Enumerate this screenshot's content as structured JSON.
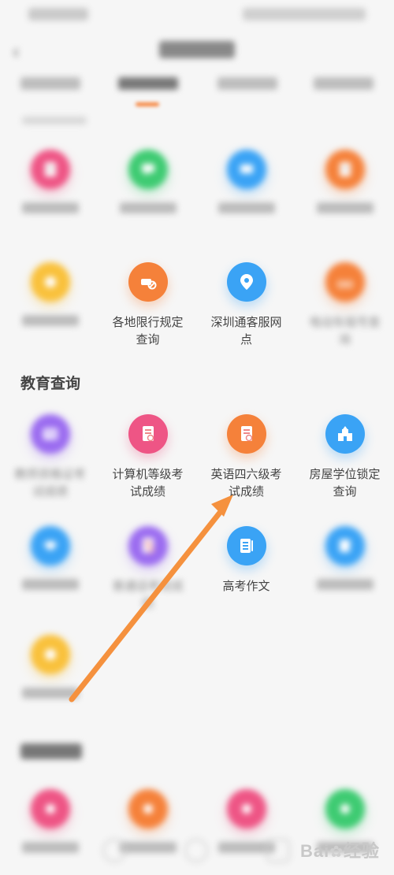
{
  "colors": {
    "pink": "#ee5585",
    "green": "#3ecb72",
    "blue": "#3aa3f5",
    "orange": "#f5813a",
    "yellow": "#f9c13c",
    "purple": "#9b6cf0",
    "arrow": "#f5913e"
  },
  "sections": [
    {
      "title": "",
      "items": [
        {
          "label": "",
          "icon": "document-icon",
          "color": "pink",
          "blurred": true
        },
        {
          "label": "",
          "icon": "chat-icon",
          "color": "green",
          "blurred": true
        },
        {
          "label": "",
          "icon": "screen-icon",
          "color": "blue",
          "blurred": true
        },
        {
          "label": "",
          "icon": "document-icon",
          "color": "orange",
          "blurred": true
        },
        {
          "label": "",
          "icon": "coin-icon",
          "color": "yellow",
          "blurred": true
        },
        {
          "label": "各地限行规定查询",
          "icon": "car-restriction-icon",
          "color": "orange",
          "blurred": false
        },
        {
          "label": "深圳通客服网点",
          "icon": "location-pin-icon",
          "color": "blue",
          "blurred": false
        },
        {
          "label": "电动车摇号查询",
          "icon": "bike-icon",
          "color": "orange",
          "blurred": true
        }
      ]
    },
    {
      "title": "教育查询",
      "items": [
        {
          "label": "教师资格证考试成绩",
          "icon": "id-card-icon",
          "color": "purple",
          "blurred": true
        },
        {
          "label": "计算机等级考试成绩",
          "icon": "certificate-icon",
          "color": "pink",
          "blurred": false
        },
        {
          "label": "英语四六级考试成绩",
          "icon": "certificate-icon",
          "color": "orange",
          "blurred": false
        },
        {
          "label": "房屋学位锁定查询",
          "icon": "school-icon",
          "color": "blue",
          "blurred": false
        },
        {
          "label": "",
          "icon": "graduation-cap-icon",
          "color": "blue",
          "blurred": true
        },
        {
          "label": "普通话考试成绩",
          "icon": "certificate-icon",
          "color": "purple",
          "blurred": true
        },
        {
          "label": "高考作文",
          "icon": "article-icon",
          "color": "blue",
          "blurred": false
        },
        {
          "label": "",
          "icon": "edit-document-icon",
          "color": "blue",
          "blurred": true
        },
        {
          "label": "",
          "icon": "coin-icon",
          "color": "yellow",
          "blurred": true
        }
      ]
    },
    {
      "title": "",
      "items": [
        {
          "label": "",
          "icon": "circle-icon",
          "color": "pink",
          "blurred": true
        },
        {
          "label": "",
          "icon": "circle-icon",
          "color": "orange",
          "blurred": true
        },
        {
          "label": "",
          "icon": "circle-icon",
          "color": "pink",
          "blurred": true
        },
        {
          "label": "",
          "icon": "circle-icon",
          "color": "green",
          "blurred": true
        }
      ]
    }
  ],
  "watermark": {
    "text": "Bai",
    "text2": "经验"
  }
}
